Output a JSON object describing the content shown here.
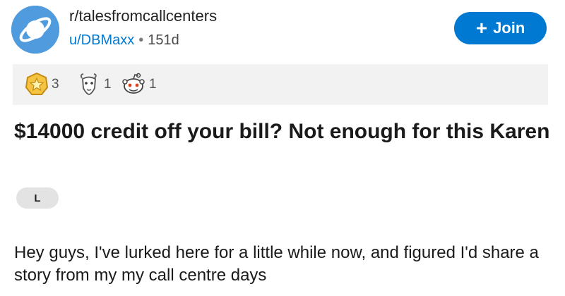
{
  "subreddit": {
    "name": "r/talesfromcallcenters",
    "icon": "planet-icon"
  },
  "post_meta": {
    "author": "u/DBMaxx",
    "separator": "•",
    "age": "151d"
  },
  "join_button": {
    "label": "Join",
    "icon": "plus-icon"
  },
  "awards": [
    {
      "icon": "gold-star-award-icon",
      "count": "3"
    },
    {
      "icon": "goat-award-icon",
      "count": "1"
    },
    {
      "icon": "snoo-award-icon",
      "count": "1"
    }
  ],
  "post": {
    "title": "$14000 credit off your bill? Not enough for this Karen",
    "flair": "L",
    "body": "Hey guys, I've lurked here for a little while now, and figured I'd share a story from my my call centre days"
  },
  "colors": {
    "accent": "#0079d3",
    "subreddit_icon_bg": "#4f9bde",
    "award_bar_bg": "#f2f2f2"
  }
}
